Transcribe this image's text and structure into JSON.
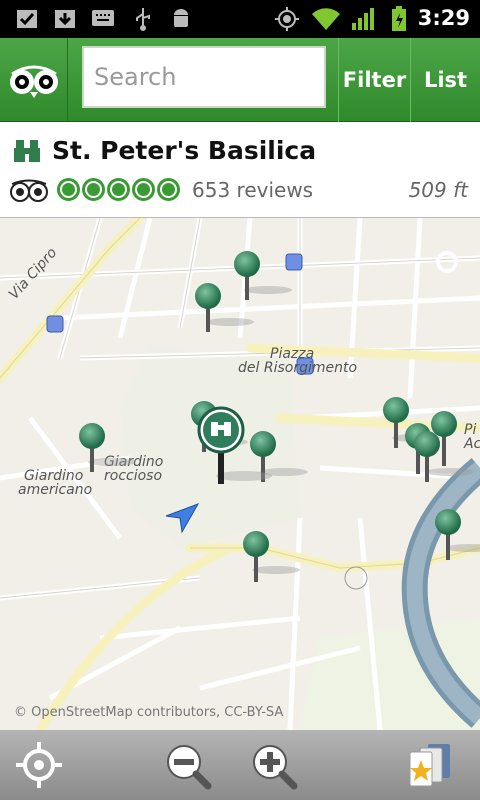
{
  "status_bar": {
    "time": "3:29",
    "icons": [
      "checkbox-icon",
      "download-icon",
      "keyboard-icon",
      "usb-icon",
      "android-icon",
      "gps-icon",
      "wifi-icon",
      "signal-icon",
      "battery-icon"
    ]
  },
  "header": {
    "search_placeholder": "Search",
    "filter_label": "Filter",
    "list_label": "List"
  },
  "place": {
    "name": "St. Peter's Basilica",
    "reviews": "653 reviews",
    "distance": "509 ft",
    "rating": 5
  },
  "map": {
    "labels": {
      "via_cipro": "Via Cipro",
      "piazza": "Piazza",
      "del_risorgimento": "del Risorgimento",
      "giardino_rocc_1": "Giardino",
      "giardino_rocc_2": "roccioso",
      "giardino_amer_1": "Giardino",
      "giardino_amer_2": "americano",
      "pi": "Pi",
      "ac": "Ac"
    },
    "copyright": "© OpenStreetMap contributors, CC-BY-SA"
  },
  "colors": {
    "brand_green": "#3a9b35",
    "header_green": "#4da646",
    "river": "#7a98ab",
    "pin": "#2f7d5c"
  }
}
